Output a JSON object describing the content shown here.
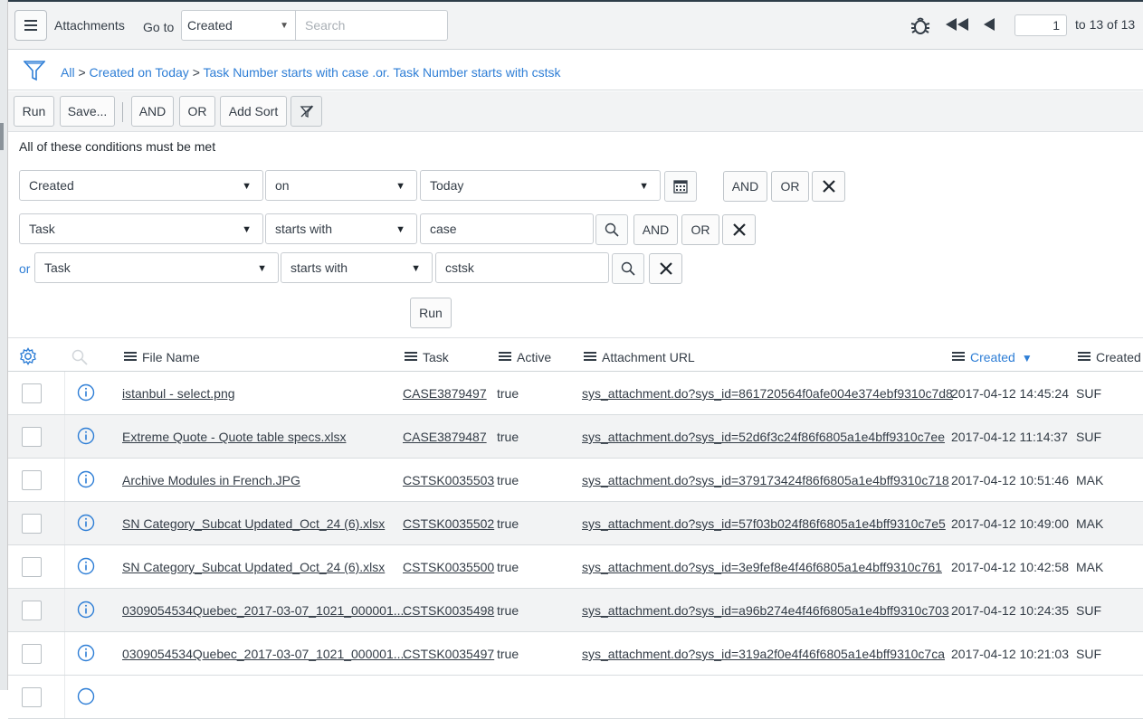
{
  "header": {
    "title": "Attachments",
    "goto_label": "Go to",
    "goto_field": "Created",
    "search_placeholder": "Search",
    "page_current": "1",
    "page_of": "to 13 of 13"
  },
  "breadcrumb": {
    "all": "All",
    "sep1": ">",
    "crumb1": "Created on Today",
    "sep2": ">",
    "crumb2": "Task Number starts with case .or. Task Number starts with cstsk"
  },
  "filter_toolbar": {
    "run": "Run",
    "save": "Save...",
    "and": "AND",
    "or": "OR",
    "add_sort": "Add Sort"
  },
  "conditions": {
    "title": "All of these conditions must be met",
    "or_label": "or",
    "rows": [
      {
        "field": "Created",
        "operator": "on",
        "value": "Today",
        "and": "AND",
        "or": "OR"
      },
      {
        "field": "Task",
        "operator": "starts with",
        "value": "case",
        "and": "AND",
        "or": "OR"
      },
      {
        "field": "Task",
        "operator": "starts with",
        "value": "cstsk"
      }
    ],
    "run": "Run"
  },
  "table": {
    "columns": {
      "file_name": "File Name",
      "task": "Task",
      "active": "Active",
      "url": "Attachment URL",
      "created": "Created",
      "created_by": "Created b"
    },
    "rows": [
      {
        "file": "istanbul - select.png",
        "task": "CASE3879497",
        "active": "true",
        "url": "sys_attachment.do?sys_id=861720564f0afe004e374ebf9310c7d8",
        "created": "2017-04-12 14:45:24",
        "by": "SUF"
      },
      {
        "file": "Extreme Quote - Quote table specs.xlsx",
        "task": "CASE3879487",
        "active": "true",
        "url": "sys_attachment.do?sys_id=52d6f3c24f86f6805a1e4bff9310c7ee",
        "created": "2017-04-12 11:14:37",
        "by": "SUF"
      },
      {
        "file": "Archive Modules in French.JPG",
        "task": "CSTSK0035503",
        "active": "true",
        "url": "sys_attachment.do?sys_id=379173424f86f6805a1e4bff9310c718",
        "created": "2017-04-12 10:51:46",
        "by": "MAK"
      },
      {
        "file": "SN Category_Subcat Updated_Oct_24 (6).xlsx",
        "task": "CSTSK0035502",
        "active": "true",
        "url": "sys_attachment.do?sys_id=57f03b024f86f6805a1e4bff9310c7e5",
        "created": "2017-04-12 10:49:00",
        "by": "MAK"
      },
      {
        "file": "SN Category_Subcat Updated_Oct_24 (6).xlsx",
        "task": "CSTSK0035500",
        "active": "true",
        "url": "sys_attachment.do?sys_id=3e9fef8e4f46f6805a1e4bff9310c761",
        "created": "2017-04-12 10:42:58",
        "by": "MAK"
      },
      {
        "file": "0309054534Quebec_2017-03-07_1021_000001....",
        "task": "CSTSK0035498",
        "active": "true",
        "url": "sys_attachment.do?sys_id=a96b274e4f46f6805a1e4bff9310c703",
        "created": "2017-04-12 10:24:35",
        "by": "SUF"
      },
      {
        "file": "0309054534Quebec_2017-03-07_1021_000001....",
        "task": "CSTSK0035497",
        "active": "true",
        "url": "sys_attachment.do?sys_id=319a2f0e4f46f6805a1e4bff9310c7ca",
        "created": "2017-04-12 10:21:03",
        "by": "SUF"
      }
    ]
  },
  "colors": {
    "accent": "#2e7ed6",
    "header_bg": "#f2f3f4",
    "text": "#343d47"
  }
}
